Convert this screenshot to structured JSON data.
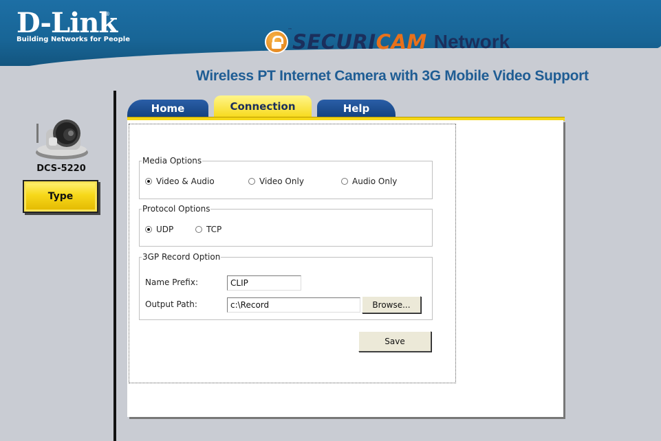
{
  "header": {
    "brand_name": "D-Link",
    "brand_tagline": "Building Networks for People",
    "brand_registered": "®",
    "securicam_part1": "SECURI",
    "securicam_part2": "CAM",
    "securicam_network": "Network",
    "trademark": "™",
    "product_title": "Wireless PT Internet Camera with 3G Mobile Video Support"
  },
  "sidebar": {
    "model": "DCS-5220",
    "type_button": "Type"
  },
  "tabs": [
    {
      "label": "Home",
      "active": false
    },
    {
      "label": "Connection",
      "active": true
    },
    {
      "label": "Help",
      "active": false
    }
  ],
  "media_options": {
    "legend": "Media Options",
    "options": [
      {
        "label": "Video & Audio",
        "checked": true
      },
      {
        "label": "Video Only",
        "checked": false
      },
      {
        "label": "Audio Only",
        "checked": false
      }
    ]
  },
  "protocol_options": {
    "legend": "Protocol Options",
    "options": [
      {
        "label": "UDP",
        "checked": true
      },
      {
        "label": "TCP",
        "checked": false
      }
    ]
  },
  "record_option": {
    "legend": "3GP Record Option",
    "name_prefix_label": "Name Prefix:",
    "name_prefix_value": "CLIP",
    "output_path_label": "Output Path:",
    "output_path_value": "c:\\Record",
    "browse_label": "Browse..."
  },
  "save_label": "Save",
  "colors": {
    "header_blue": "#186596",
    "title_blue": "#1f5d94",
    "tab_active_yellow": "#f7da1c",
    "tab_inactive_blue": "#14427f",
    "securicam_orange": "#e8711b",
    "background": "#c9ccd3"
  }
}
